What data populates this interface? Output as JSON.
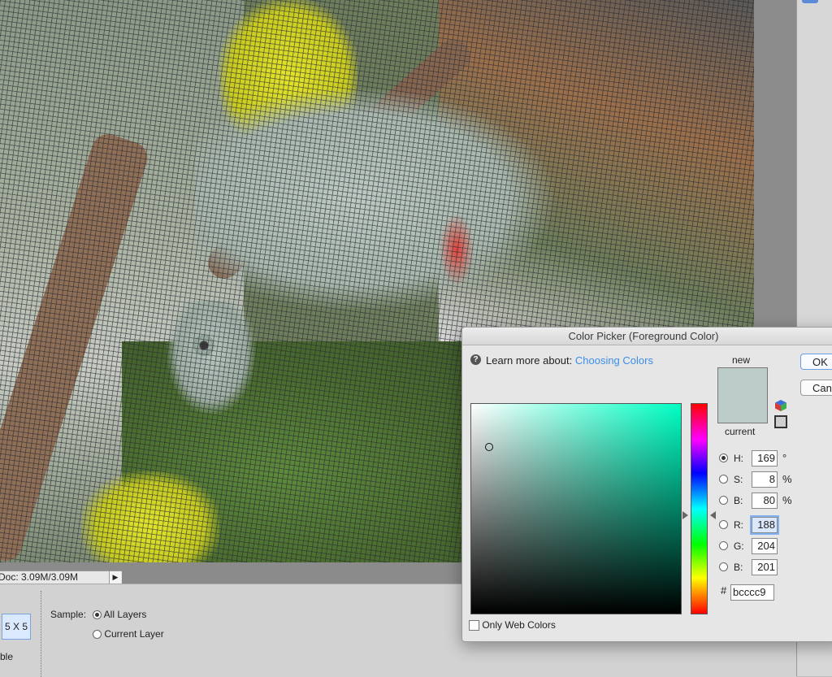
{
  "status_bar": {
    "doc_info": "Doc: 3.09M/3.09M",
    "menu_arrow": "▶"
  },
  "options_bar": {
    "sample_size": "5 X 5",
    "truncated_label": "ble",
    "sample_label": "Sample:",
    "sample_options": [
      {
        "label": "All Layers",
        "selected": true
      },
      {
        "label": "Current Layer",
        "selected": false
      }
    ]
  },
  "color_picker": {
    "title": "Color Picker (Foreground Color)",
    "help_glyph": "?",
    "learn_prefix": "Learn more about:",
    "learn_link": "Choosing Colors",
    "new_label": "new",
    "current_label": "current",
    "new_color": "#bccccc9",
    "swatch_color": "#bcccc9",
    "fields": {
      "H": {
        "label": "H:",
        "value": "169",
        "unit": "°",
        "selected": true
      },
      "S": {
        "label": "S:",
        "value": "8",
        "unit": "%"
      },
      "Bri": {
        "label": "B:",
        "value": "80",
        "unit": "%"
      },
      "R": {
        "label": "R:",
        "value": "188"
      },
      "G": {
        "label": "G:",
        "value": "204"
      },
      "Blu": {
        "label": "B:",
        "value": "201"
      }
    },
    "hex_symbol": "#",
    "hex_value": "bcccc9",
    "only_web_colors": "Only Web Colors",
    "buttons": {
      "ok": "OK",
      "cancel": "Cancel"
    }
  }
}
